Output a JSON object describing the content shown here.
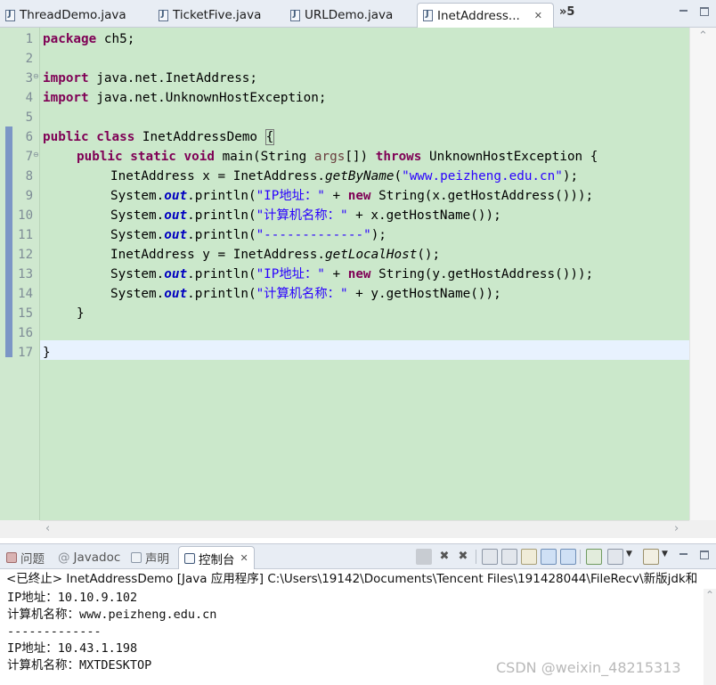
{
  "editor_tabs": [
    {
      "label": "ThreadDemo.java"
    },
    {
      "label": "TicketFive.java"
    },
    {
      "label": "URLDemo.java"
    },
    {
      "label": "InetAddress..."
    }
  ],
  "tab_overflow": "»5",
  "code": {
    "line_numbers": [
      "1",
      "2",
      "3",
      "4",
      "5",
      "6",
      "7",
      "8",
      "9",
      "10",
      "11",
      "12",
      "13",
      "14",
      "15",
      "16",
      "17"
    ],
    "package_kw": "package",
    "package_name": " ch5;",
    "import_kw": "import",
    "import1": " java.net.InetAddress;",
    "import2": " java.net.UnknownHostException;",
    "public_kw": "public",
    "class_kw": "class",
    "class_name": " InetAddressDemo ",
    "open_brace": "{",
    "static_kw": "static",
    "void_kw": "void",
    "main_sig_a": " main(String ",
    "args": "args",
    "main_sig_b": "[]) ",
    "throws_kw": "throws",
    "exception": " UnknownHostException {",
    "inet_decl_x": "InetAddress x = InetAddress.",
    "get_by_name": "getByName",
    "host_str": "\"www.peizheng.edu.cn\"",
    "close_paren_semi": ");",
    "system": "System.",
    "out": "out",
    "println": ".println(",
    "ip_str": "\"IP地址：\"",
    "plus": " + ",
    "new_kw": "new",
    "string_x": " String(x.getHostAddress()));",
    "name_str": "\"计算机名称：\"",
    "host_x": " + x.getHostName());",
    "dash_str": "\"-------------\"",
    "inet_decl_y": "InetAddress y = InetAddress.",
    "get_local": "getLocalHost",
    "local_tail": "();",
    "string_y": " String(y.getHostAddress()));",
    "host_y": " + y.getHostName());",
    "close_brace": "}"
  },
  "console_tabs": [
    {
      "label": "问题"
    },
    {
      "label": "Javadoc"
    },
    {
      "label": "声明"
    },
    {
      "label": "控制台"
    }
  ],
  "console_desc": "<已终止> InetAddressDemo [Java 应用程序] C:\\Users\\19142\\Documents\\Tencent Files\\191428044\\FileRecv\\新版jdk和",
  "console_output": [
    "IP地址：10.10.9.102",
    "计算机名称：www.peizheng.edu.cn",
    "-------------",
    "IP地址：10.43.1.198",
    "计算机名称：MXTDESKTOP"
  ],
  "watermark": "CSDN @weixin_48215313",
  "colors": {
    "code_bg": "#cbe8cb",
    "keyword": "#7f0055",
    "string": "#2a00ff",
    "field": "#0000c0"
  }
}
